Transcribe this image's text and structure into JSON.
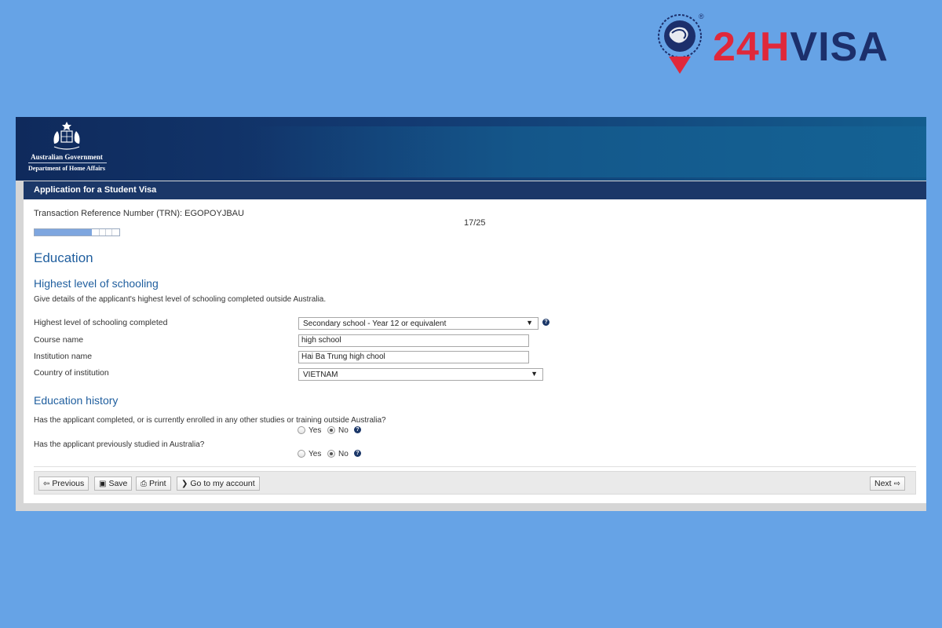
{
  "brand": {
    "text_red": "24H",
    "text_navy": "VISA",
    "reg": "®",
    "colors": {
      "red": "#e0283a",
      "navy": "#1c2f6b"
    }
  },
  "gov": {
    "line1": "Australian Government",
    "line2": "Department of Home Affairs"
  },
  "app": {
    "title": "Application for a Student Visa"
  },
  "trn": {
    "text": "Transaction Reference Number (TRN): EGOPOYJBAU"
  },
  "progress": {
    "page_label": "17/25",
    "fraction": 0.68
  },
  "education": {
    "heading": "Education",
    "schooling": {
      "heading": "Highest level of schooling",
      "description": "Give details of the applicant's highest level of schooling completed outside Australia.",
      "fields": {
        "highest_level": {
          "label": "Highest level of schooling completed",
          "value": "Secondary school - Year 12 or equivalent"
        },
        "course_name": {
          "label": "Course name",
          "value": "high school"
        },
        "institution_name": {
          "label": "Institution name",
          "value": "Hai Ba Trung high chool"
        },
        "country": {
          "label": "Country of institution",
          "value": "VIETNAM"
        }
      }
    },
    "history": {
      "heading": "Education history",
      "q1": {
        "text": "Has the applicant completed, or is currently enrolled in any other studies or training outside Australia?",
        "yes": "Yes",
        "no": "No",
        "selected": "No"
      },
      "q2": {
        "text": "Has the applicant previously studied in Australia?",
        "yes": "Yes",
        "no": "No",
        "selected": "No"
      }
    }
  },
  "footer": {
    "previous": "Previous",
    "save": "Save",
    "print": "Print",
    "account": "Go to my account",
    "next": "Next"
  },
  "icons": {
    "help": "help-icon",
    "dropdown": "chevron-down-icon"
  }
}
